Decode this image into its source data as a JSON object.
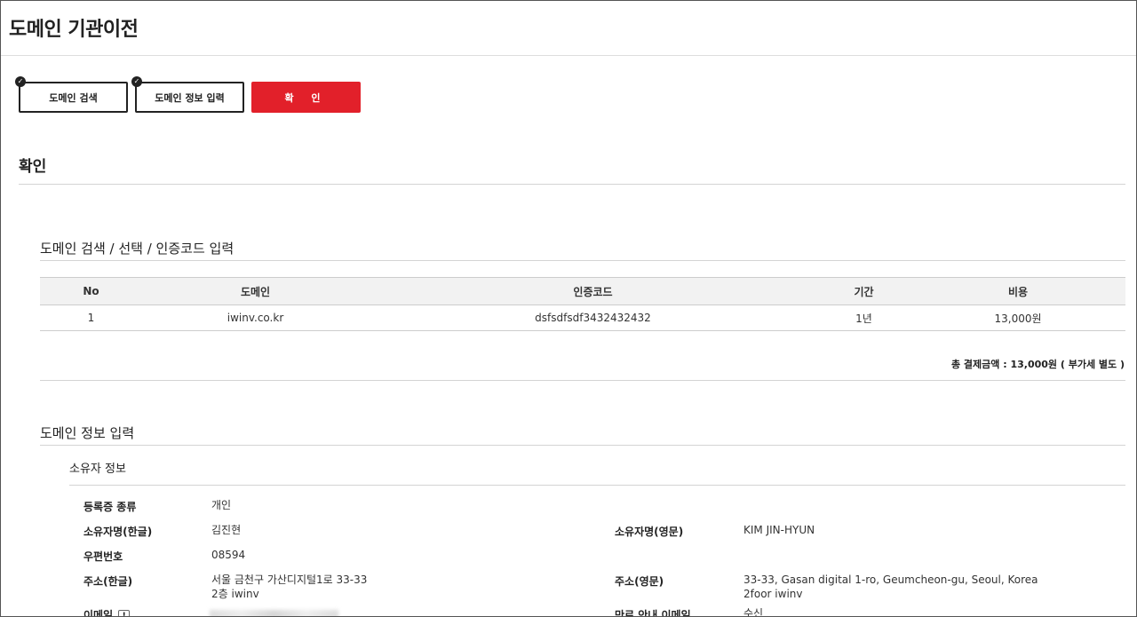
{
  "page": {
    "title": "도메인 기관이전"
  },
  "steps": [
    {
      "label": "도메인 검색",
      "done": true
    },
    {
      "label": "도메인 정보 입력",
      "done": true
    },
    {
      "label": "확 인",
      "active": true
    }
  ],
  "confirm": {
    "title": "확인"
  },
  "search_section": {
    "title": "도메인 검색 / 선택 / 인증코드 입력",
    "columns": [
      "No",
      "도메인",
      "인증코드",
      "기간",
      "비용"
    ],
    "rows": [
      [
        "1",
        "iwinv.co.kr",
        "dsfsdfsdf3432432432",
        "1년",
        "13,000원"
      ]
    ],
    "total": "총 결제금액 : 13,000원 ( 부가세 별도 )"
  },
  "info_section": {
    "title": "도메인 정보 입력",
    "owner": {
      "title": "소유자 정보",
      "reg_type_label": "등록증 종류",
      "reg_type_value": "개인",
      "name_ko_label": "소유자명(한글)",
      "name_ko_value": "김진현",
      "name_en_label": "소유자명(영문)",
      "name_en_value": "KIM JIN-HYUN",
      "zip_label": "우편번호",
      "zip_value": "08594",
      "addr_ko_label": "주소(한글)",
      "addr_ko_line1": "서울 금천구 가산디지털1로 33-33",
      "addr_ko_line2": "2층 iwinv",
      "addr_en_label": "주소(영문)",
      "addr_en_line1": "33-33, Gasan digital 1-ro, Geumcheon-gu, Seoul, Korea",
      "addr_en_line2": "2foor iwinv",
      "email_label": "이메일",
      "expiry_email_label": "만료 안내 이메일",
      "expiry_email_value": "수신"
    }
  },
  "icons": {
    "check": "check-icon",
    "info": "info-icon"
  },
  "colors": {
    "accent": "#e2202a"
  }
}
